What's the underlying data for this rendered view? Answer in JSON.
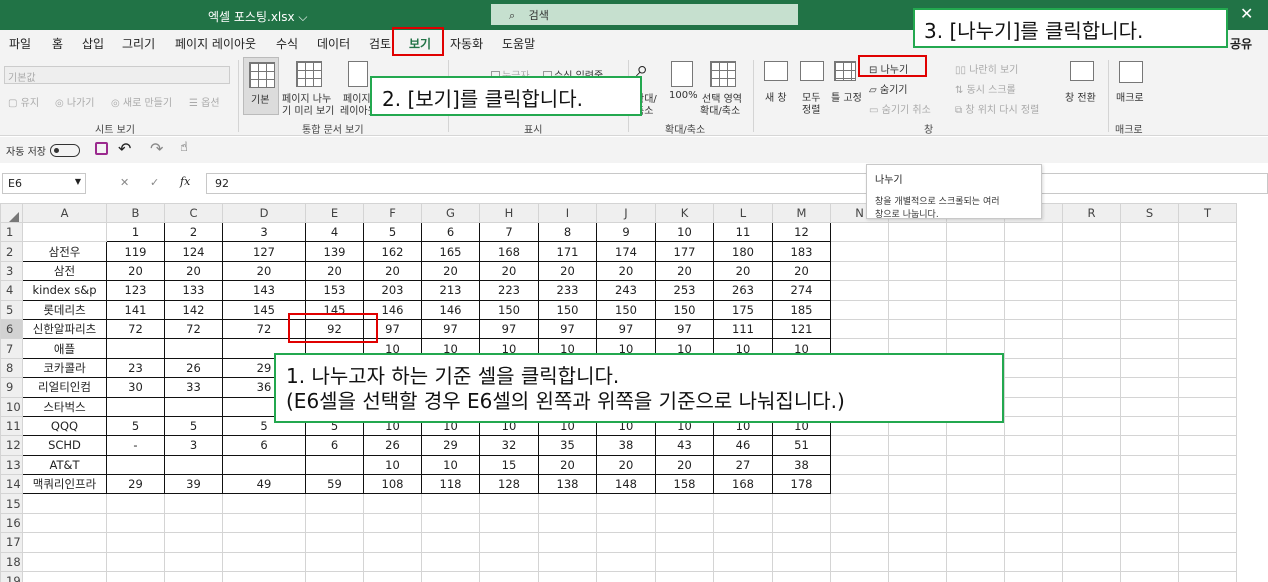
{
  "window": {
    "title": "엑셀 포스팅.xlsx ⌵",
    "search_placeholder": "검색",
    "close": "✕"
  },
  "menu": {
    "tabs": [
      "파일",
      "홈",
      "삽입",
      "그리기",
      "페이지 레이아웃",
      "수식",
      "데이터",
      "검토",
      "보기",
      "자동화",
      "도움말"
    ],
    "active": "보기",
    "share": "공유"
  },
  "ribbon": {
    "sheet_view": {
      "style_value": "기본값",
      "keep": "유지",
      "exit": "나가기",
      "new": "새로 만들기",
      "options": "옵션",
      "label": "시트 보기"
    },
    "workbook_views": {
      "normal": "기본",
      "page_break_1": "페이지 나누",
      "page_break_2": "기 미리 보기",
      "page_layout_1": "페이지",
      "page_layout_2": "레이아웃",
      "label": "통합 문서 보기"
    },
    "show": {
      "ruler": "눈금자",
      "formula_bar": "수식 입력줄",
      "label": "표시"
    },
    "zoom": {
      "zoom_1": "확대/",
      "zoom_2": "축소",
      "pct": "100%",
      "sel_1": "선택 영역",
      "sel_2": "확대/축소",
      "label": "확대/축소"
    },
    "window": {
      "new_window": "새 창",
      "arrange_1": "모두",
      "arrange_2": "정렬",
      "freeze": "틀 고정",
      "split": "나누기",
      "hide": "숨기기",
      "unhide": "숨기기 취소",
      "side_by_side": "나란히 보기",
      "sync_scroll": "동시 스크롤",
      "reset": "창 위치 다시 정렬",
      "switch": "창 전환",
      "label": "창"
    },
    "macros": {
      "btn": "매크로",
      "label": "매크로"
    }
  },
  "qat": {
    "autosave": "자동 저장",
    "undo": "↶",
    "redo": "↷"
  },
  "formula_bar": {
    "name_box": "E6",
    "cancel": "✕",
    "enter": "✓",
    "fx": "fx",
    "value": "92"
  },
  "tooltip": {
    "title": "나누기",
    "line1": "창을 개별적으로 스크롤되는 여러",
    "line2": "창으로 나눕니다."
  },
  "sheet": {
    "columns": [
      "A",
      "B",
      "C",
      "D",
      "E",
      "F",
      "G",
      "H",
      "I",
      "J",
      "K",
      "L",
      "M",
      "N",
      "O",
      "P",
      "Q",
      "R",
      "S",
      "T"
    ],
    "rows": [
      [
        "",
        "1",
        "2",
        "3",
        "4",
        "5",
        "6",
        "7",
        "8",
        "9",
        "10",
        "11",
        "12"
      ],
      [
        "삼전우",
        "119",
        "124",
        "127",
        "139",
        "162",
        "165",
        "168",
        "171",
        "174",
        "177",
        "180",
        "183"
      ],
      [
        "삼전",
        "20",
        "20",
        "20",
        "20",
        "20",
        "20",
        "20",
        "20",
        "20",
        "20",
        "20",
        "20"
      ],
      [
        "kindex s&p",
        "123",
        "133",
        "143",
        "153",
        "203",
        "213",
        "223",
        "233",
        "243",
        "253",
        "263",
        "274"
      ],
      [
        "롯데리츠",
        "141",
        "142",
        "145",
        "145",
        "146",
        "146",
        "150",
        "150",
        "150",
        "150",
        "175",
        "185"
      ],
      [
        "신한알파리츠",
        "72",
        "72",
        "72",
        "92",
        "97",
        "97",
        "97",
        "97",
        "97",
        "97",
        "111",
        "121"
      ],
      [
        "애플",
        "",
        "",
        "",
        "",
        "10",
        "10",
        "10",
        "10",
        "10",
        "10",
        "10",
        "10"
      ],
      [
        "코카콜라",
        "23",
        "26",
        "29",
        "",
        "",
        "",
        "",
        "",
        "",
        "",
        "",
        ""
      ],
      [
        "리얼티인컴",
        "30",
        "33",
        "36",
        "",
        "",
        "",
        "",
        "",
        "",
        "",
        "",
        ""
      ],
      [
        "스타벅스",
        "",
        "",
        "",
        "",
        "",
        "",
        "",
        "",
        "",
        "",
        "",
        ""
      ],
      [
        "QQQ",
        "5",
        "5",
        "5",
        "5",
        "10",
        "10",
        "10",
        "10",
        "10",
        "10",
        "10",
        "10"
      ],
      [
        "SCHD",
        "-",
        "3",
        "6",
        "6",
        "26",
        "29",
        "32",
        "35",
        "38",
        "43",
        "46",
        "51"
      ],
      [
        "AT&T",
        "",
        "",
        "",
        "",
        "10",
        "10",
        "15",
        "20",
        "20",
        "20",
        "27",
        "38"
      ],
      [
        "맥쿼리인프라",
        "29",
        "39",
        "49",
        "59",
        "108",
        "118",
        "128",
        "138",
        "148",
        "158",
        "168",
        "178"
      ],
      [
        "",
        "",
        "",
        "",
        "",
        "",
        "",
        "",
        "",
        "",
        "",
        "",
        ""
      ],
      [
        "",
        "",
        "",
        "",
        "",
        "",
        "",
        "",
        "",
        "",
        "",
        "",
        ""
      ],
      [
        "",
        "",
        "",
        "",
        "",
        "",
        "",
        "",
        "",
        "",
        "",
        "",
        ""
      ],
      [
        "",
        "",
        "",
        "",
        "",
        "",
        "",
        "",
        "",
        "",
        "",
        "",
        ""
      ],
      [
        "",
        "",
        "",
        "",
        "",
        "",
        "",
        "",
        "",
        "",
        "",
        "",
        ""
      ]
    ]
  },
  "annotations": {
    "step1_line1": "1.  나누고자 하는 기준 셀을 클릭합니다.",
    "step1_line2": "(E6셀을 선택할 경우 E6셀의 왼쪽과 위쪽을 기준으로 나눠집니다.)",
    "step2": "2. [보기]를 클릭합니다.",
    "step3": "3. [나누기]를 클릭합니다."
  },
  "colors": {
    "excel_green": "#217346",
    "callout_border": "#23a84f",
    "highlight_red": "#e00000"
  }
}
